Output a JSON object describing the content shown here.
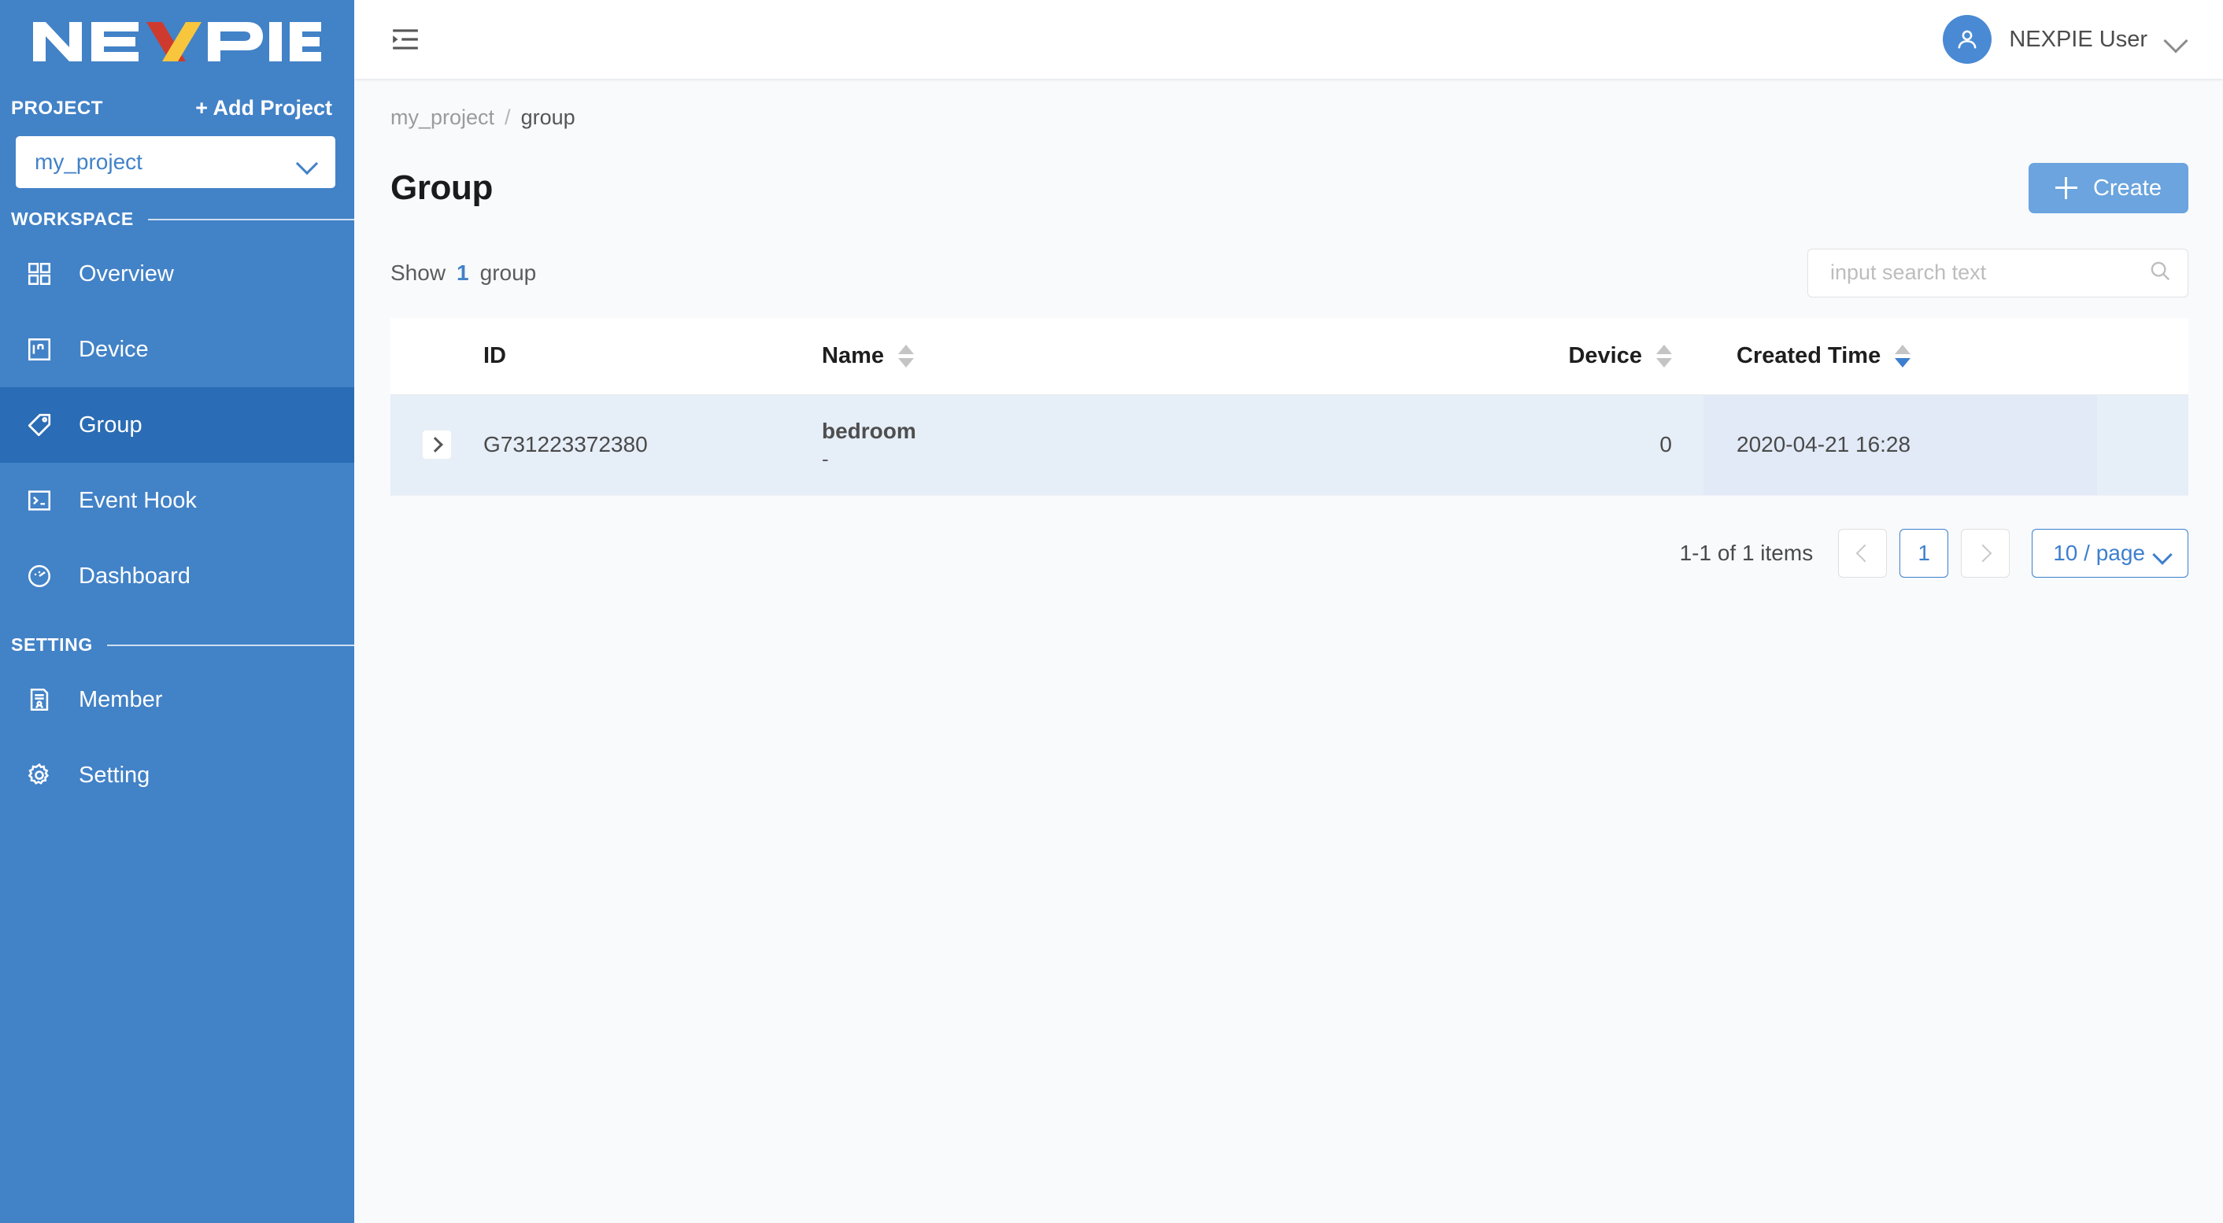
{
  "sidebar": {
    "logo_text": "NEXPIE",
    "project_label": "PROJECT",
    "add_project_label": "+ Add Project",
    "project_selected": "my_project",
    "workspace_label": "WORKSPACE",
    "setting_label": "SETTING",
    "workspace_items": [
      {
        "label": "Overview",
        "icon": "grid-icon",
        "active": false
      },
      {
        "label": "Device",
        "icon": "device-icon",
        "active": false
      },
      {
        "label": "Group",
        "icon": "tag-icon",
        "active": true
      },
      {
        "label": "Event Hook",
        "icon": "terminal-icon",
        "active": false
      },
      {
        "label": "Dashboard",
        "icon": "gauge-icon",
        "active": false
      }
    ],
    "setting_items": [
      {
        "label": "Member",
        "icon": "member-icon",
        "active": false
      },
      {
        "label": "Setting",
        "icon": "gear-icon",
        "active": false
      }
    ]
  },
  "topbar": {
    "fold_icon": "menu-fold-icon",
    "user_name": "NEXPIE User",
    "avatar_icon": "user-avatar-icon",
    "caret_icon": "chevron-down-icon"
  },
  "breadcrumb": {
    "project": "my_project",
    "separator": "/",
    "current": "group"
  },
  "page": {
    "title": "Group",
    "create_label": "Create"
  },
  "filter": {
    "show_prefix": "Show",
    "count": "1",
    "show_suffix": "group",
    "search_placeholder": "input search text",
    "search_value": "",
    "search_icon": "search-icon"
  },
  "table": {
    "columns": [
      {
        "key": "expand",
        "label": "",
        "sortable": false
      },
      {
        "key": "id",
        "label": "ID",
        "sortable": false
      },
      {
        "key": "name",
        "label": "Name",
        "sortable": true,
        "sort_state": "none"
      },
      {
        "key": "device",
        "label": "Device",
        "sortable": true,
        "sort_state": "none"
      },
      {
        "key": "created",
        "label": "Created Time",
        "sortable": true,
        "sort_state": "desc"
      }
    ],
    "rows": [
      {
        "id": "G731223372380",
        "name": "bedroom",
        "name_sub": "-",
        "device": "0",
        "created": "2020-04-21 16:28"
      }
    ]
  },
  "pagination": {
    "total_text": "1-1 of 1 items",
    "prev_label": "‹",
    "next_label": "›",
    "pages": [
      "1"
    ],
    "current_page": "1",
    "page_size_label": "10 / page"
  },
  "colors": {
    "sidebar_bg": "#4282c7",
    "sidebar_active": "#2a6cb5",
    "accent": "#3d7fce",
    "create_btn": "#6ba4de",
    "row_bg": "#e6eef8",
    "row_sorted_bg": "#e1eaf6",
    "logo_x_red": "#cf3a2e",
    "logo_x_yellow": "#f7c63d"
  }
}
